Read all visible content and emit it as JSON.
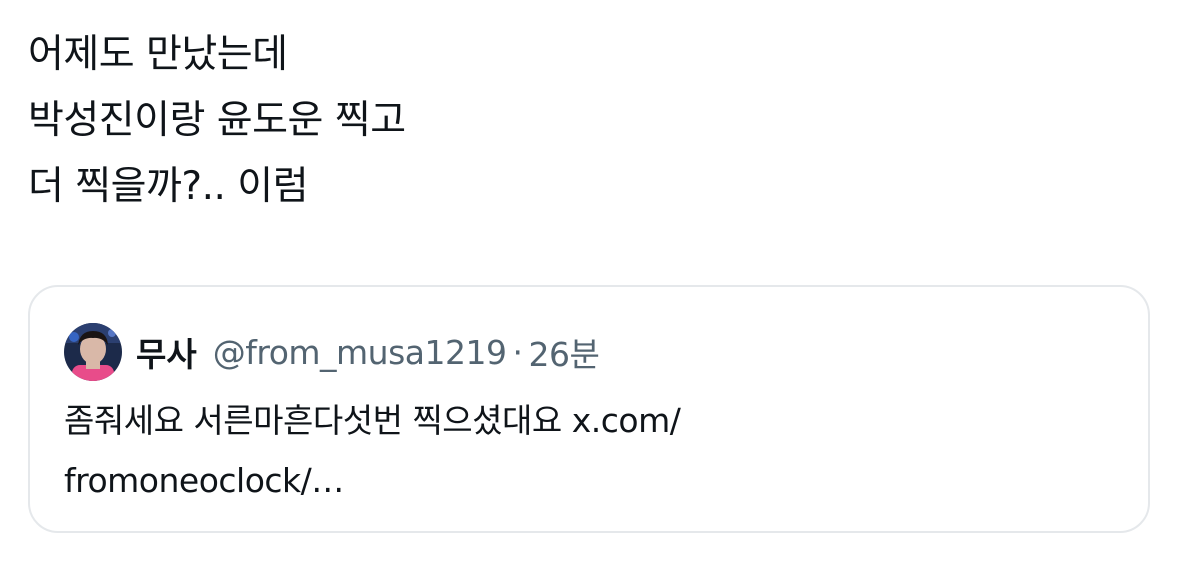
{
  "tweet": {
    "lines": [
      "어제도 만났는데",
      "박성진이랑 윤도운 찍고",
      "더 찍을까?.. 이럼"
    ]
  },
  "quoted_tweet": {
    "display_name": "무사",
    "handle": "@from_musa1219",
    "separator": "·",
    "time": "26분",
    "text_prefix": "좀줘세요 서른마흔다섯번 찍으셨대요 ",
    "link_part1": "x.com/",
    "link_part2": "fromoneoclock/…",
    "avatar_icon": "profile-photo",
    "avatar_colors": {
      "background": "#1c2a4a",
      "accent": "#e84c8a",
      "glow": "#3a6fd8"
    }
  }
}
